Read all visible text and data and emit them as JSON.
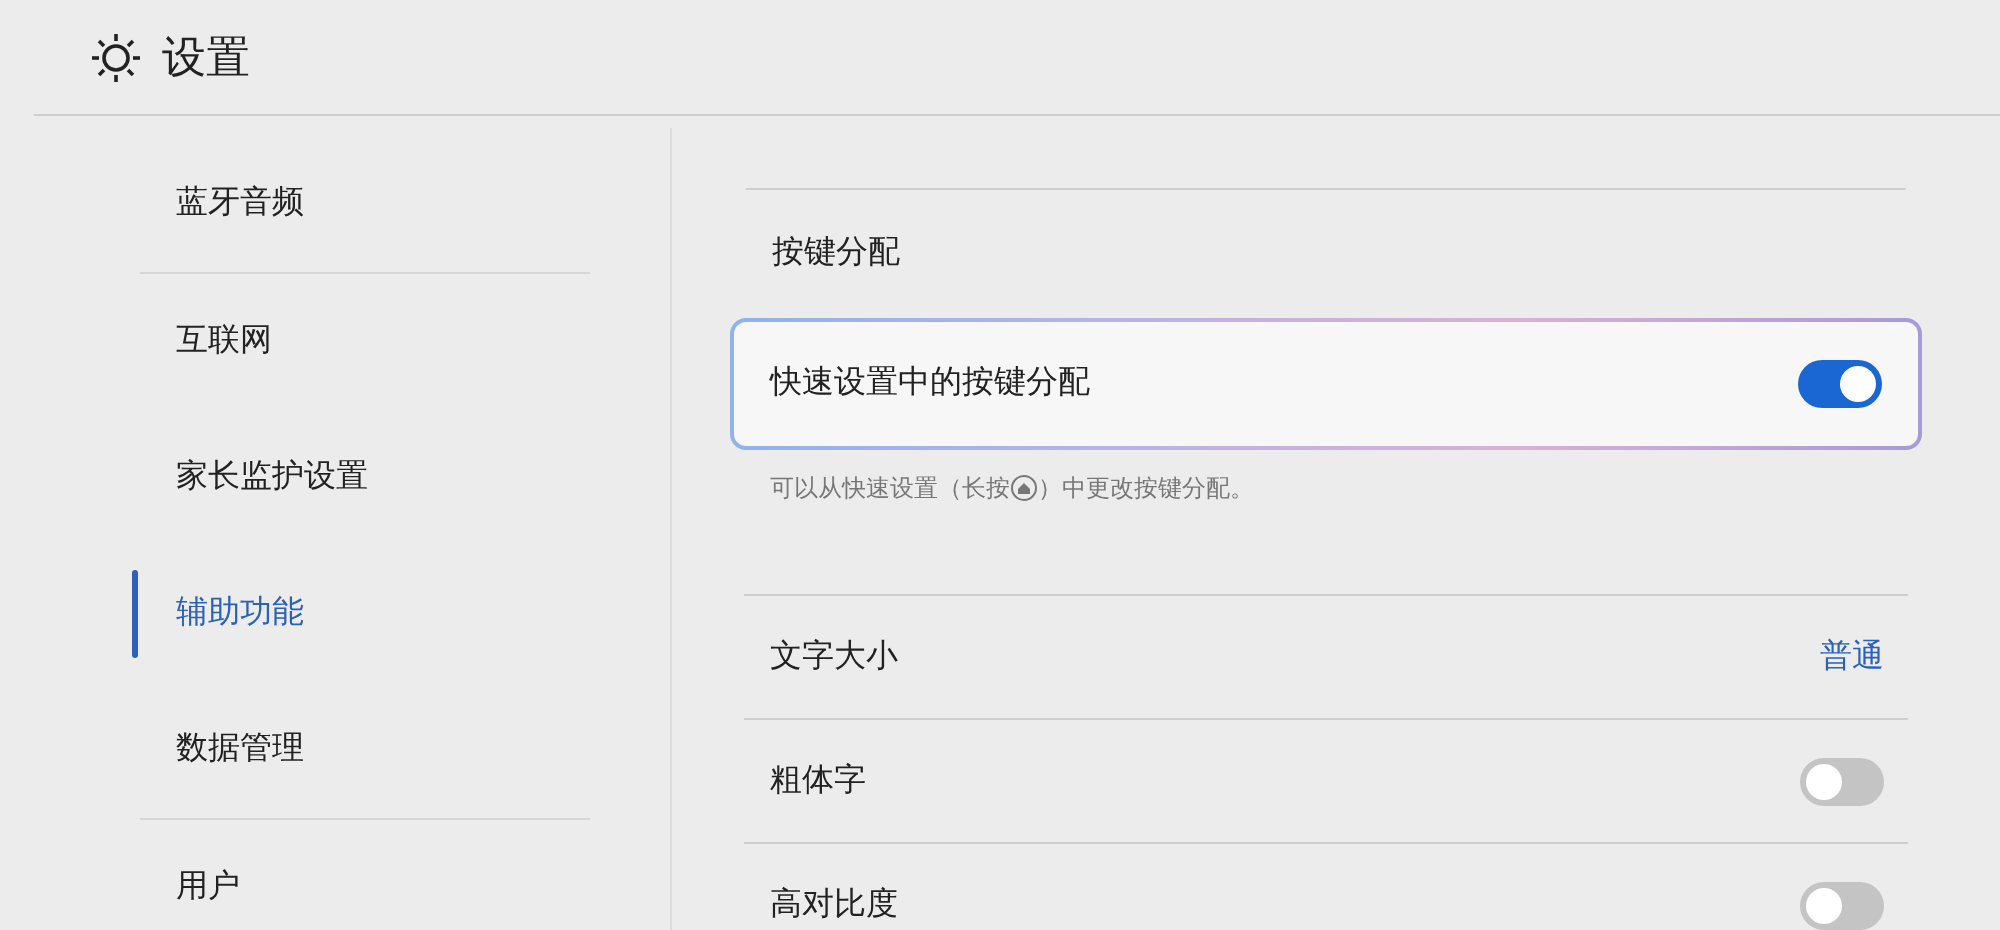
{
  "header": {
    "title": "设置"
  },
  "sidebar": {
    "groups": [
      {
        "items": [
          {
            "label": "蓝牙音频",
            "selected": false
          }
        ]
      },
      {
        "items": [
          {
            "label": "互联网",
            "selected": false
          },
          {
            "label": "家长监护设置",
            "selected": false
          },
          {
            "label": "辅助功能",
            "selected": true
          },
          {
            "label": "数据管理",
            "selected": false
          }
        ]
      },
      {
        "items": [
          {
            "label": "用户",
            "selected": false
          }
        ]
      }
    ]
  },
  "section": {
    "title": "按键分配",
    "card": {
      "label": "快速设置中的按键分配",
      "on": true
    },
    "hint": {
      "before": "可以从快速设置（长按",
      "after": "）中更改按键分配。"
    }
  },
  "rows": [
    {
      "kind": "value",
      "label": "文字大小",
      "value": "普通"
    },
    {
      "kind": "toggle",
      "label": "粗体字",
      "on": false
    },
    {
      "kind": "toggle",
      "label": "高对比度",
      "on": false
    }
  ]
}
